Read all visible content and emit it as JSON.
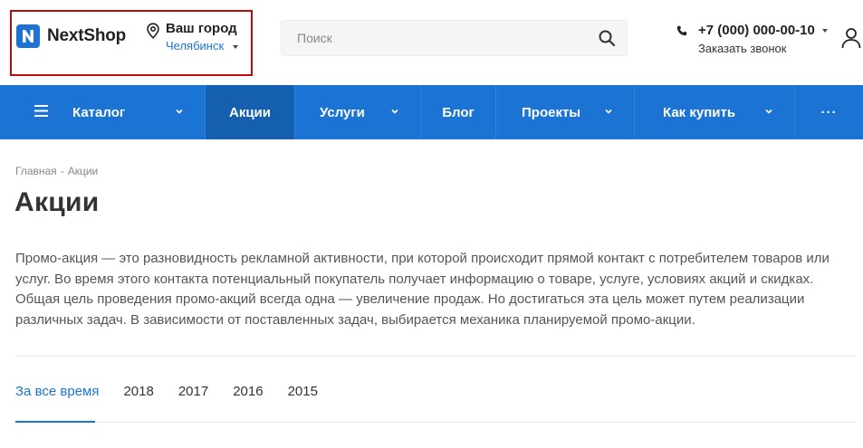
{
  "header": {
    "logo_text": "NextShop",
    "city_label": "Ваш город",
    "city_value": "Челябинск",
    "search_placeholder": "Поиск",
    "phone": "+7 (000) 000-00-10",
    "callback_label": "Заказать звонок"
  },
  "nav": {
    "items": [
      {
        "label": "Каталог"
      },
      {
        "label": "Акции"
      },
      {
        "label": "Услуги"
      },
      {
        "label": "Блог"
      },
      {
        "label": "Проекты"
      },
      {
        "label": "Как купить"
      },
      {
        "label": "···"
      }
    ]
  },
  "breadcrumb": {
    "home": "Главная",
    "separator": "-",
    "current": "Акции"
  },
  "page": {
    "title": "Акции",
    "description": "Промо-акция — это разновидность рекламной активности, при которой происходит прямой контакт с потребителем товаров или услуг. Во время этого контакта потенциальный покупатель получает информацию о товаре, услуге, условиях акций и скидках. Общая цель проведения промо-акций всегда одна — увеличение продаж. Но достигаться эта цель может путем реализации различных задач. В зависимости от поставленных задач, выбирается механика планируемой промо-акции."
  },
  "years": {
    "items": [
      "За все время",
      "2018",
      "2017",
      "2016",
      "2015"
    ]
  },
  "colors": {
    "accent": "#1b74d3",
    "nav_active": "#155fb0",
    "highlight_box": "#c10b0b"
  }
}
